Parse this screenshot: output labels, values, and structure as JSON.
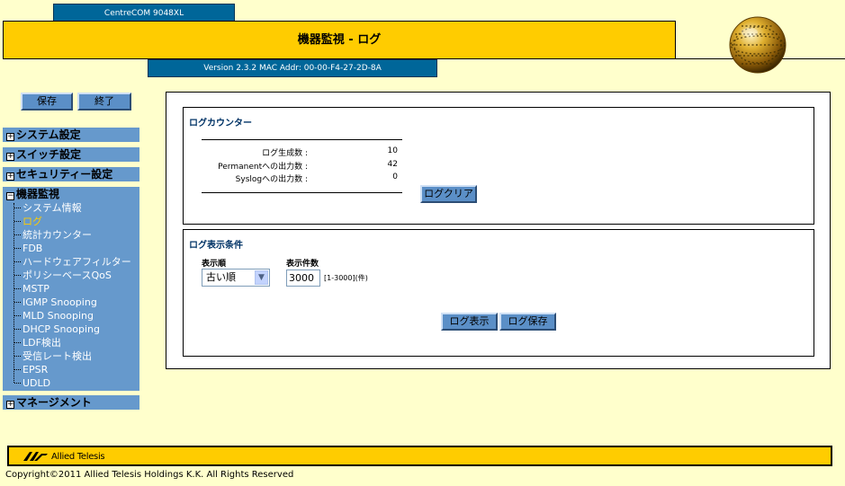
{
  "header": {
    "model": "CentreCOM 9048XL",
    "title": "機器監視 - ログ",
    "version": "Version 2.3.2 MAC Addr: 00-00-F4-27-2D-8A"
  },
  "actions": {
    "save": "保存",
    "exit": "終了"
  },
  "menu": {
    "system": "システム設定",
    "switch": "スイッチ設定",
    "security": "セキュリティー設定",
    "monitoring": "機器監視",
    "monitoring_items": [
      "システム情報",
      "ログ",
      "統計カウンター",
      "FDB",
      "ハードウェアフィルター",
      "ポリシーベースQoS",
      "MSTP",
      "IGMP Snooping",
      "MLD Snooping",
      "DHCP Snooping",
      "LDF検出",
      "受信レート検出",
      "EPSR",
      "UDLD"
    ],
    "active_item": "ログ",
    "management": "マネージメント"
  },
  "log_counter": {
    "title": "ログカウンター",
    "rows": [
      {
        "label": "ログ生成数 :",
        "value": "10"
      },
      {
        "label": "Permanentへの出力数 :",
        "value": "42"
      },
      {
        "label": "Syslogへの出力数 :",
        "value": "0"
      }
    ],
    "clear_button": "ログクリア"
  },
  "display_conditions": {
    "title": "ログ表示条件",
    "order_label": "表示順",
    "order_value": "古い順",
    "count_label": "表示件数",
    "count_value": "3000",
    "count_range": "[1-3000](件)",
    "show_button": "ログ表示",
    "save_button": "ログ保存"
  },
  "footer": {
    "brand": "Allied Telesis",
    "copyright": "Copyright©2011 Allied Telesis Holdings K.K. All Rights Reserved"
  },
  "colors": {
    "background": "#ffffcc",
    "header_yellow": "#ffcc00",
    "header_blue": "#006699",
    "menu_blue": "#6699cc",
    "active_menu_text": "#ffcc00"
  }
}
